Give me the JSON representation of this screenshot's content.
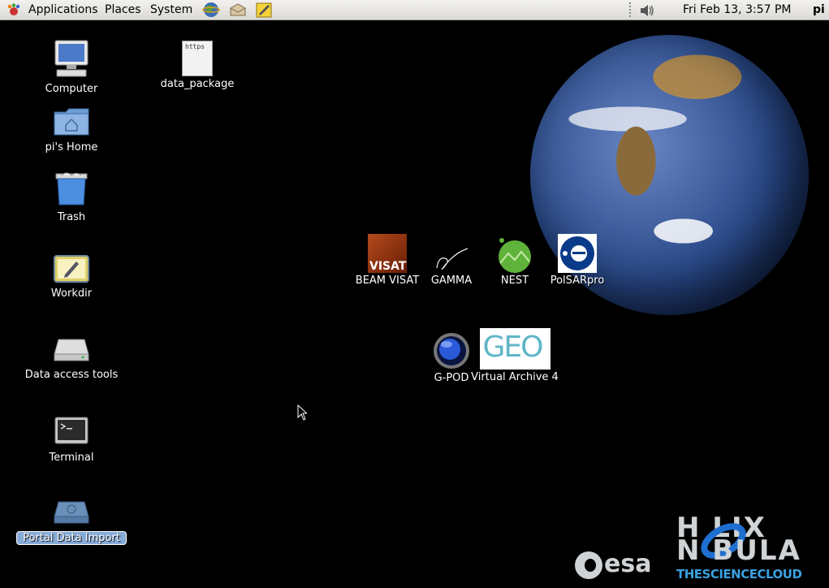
{
  "panel": {
    "menus": [
      "Applications",
      "Places",
      "System"
    ],
    "launchers": [
      "web-browser-icon",
      "mail-client-icon",
      "text-editor-icon"
    ],
    "volume_icon": "speaker-icon",
    "clock": "Fri Feb 13,  3:57 PM",
    "user": "pi"
  },
  "desktop_icons": {
    "computer": "Computer",
    "home": "pi's Home",
    "trash": "Trash",
    "workdir": "Workdir",
    "data_access": "Data access tools",
    "terminal": "Terminal",
    "portal": "Portal Data Import",
    "data_package": "data_package",
    "data_package_thumb": "https",
    "beam": "BEAM VISAT",
    "beam_badge": "VISAT",
    "gamma": "GAMMA",
    "nest": "NEST",
    "polsar": "PolSARpro",
    "gpod": "G-POD",
    "va4": "Virtual Archive 4",
    "va4_badge": "GEO"
  },
  "logos": {
    "helix_line1": "H   LIX",
    "helix_line2": "N   BULA",
    "helix_line3": "THESCIENCECLOUD",
    "esa": "esa"
  },
  "colors": {
    "panel_bg": "#e8e6e1",
    "selection": "#86abd9",
    "desktop": "#000000"
  }
}
